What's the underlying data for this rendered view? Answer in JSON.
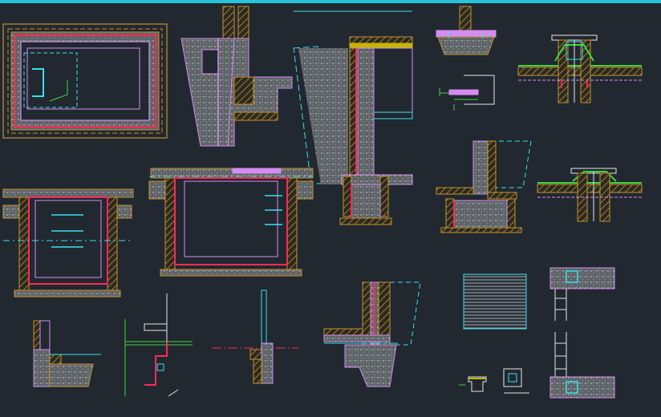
{
  "drawing": {
    "background": "#212830",
    "frame_color": "#27c4d8",
    "colors": {
      "wall_outline": "#d58cf0",
      "concrete_fill": "#6a6f72",
      "hatch": "#c8912a",
      "membrane": "#ff2a55",
      "dimension": "#39e0ee",
      "insulation": "#c8b400",
      "green_line": "#3ed43e",
      "white_line": "#e6e6e6"
    },
    "details": [
      {
        "name": "pool-plan"
      },
      {
        "name": "wall-step-section"
      },
      {
        "name": "wall-tall-section"
      },
      {
        "name": "flange-pipe-small"
      },
      {
        "name": "pipe-penetration-detail-1"
      },
      {
        "name": "small-fitting-detail"
      },
      {
        "name": "pit-section-small"
      },
      {
        "name": "pit-section-large"
      },
      {
        "name": "wall-base-section"
      },
      {
        "name": "pipe-penetration-detail-2"
      },
      {
        "name": "ladder-rungs-detail"
      },
      {
        "name": "grating-plan"
      },
      {
        "name": "ladder-elevation"
      },
      {
        "name": "edge-detail-small"
      },
      {
        "name": "red-profile-detail"
      },
      {
        "name": "post-detail"
      },
      {
        "name": "wall-footing-section"
      },
      {
        "name": "small-bracket-details"
      }
    ]
  }
}
